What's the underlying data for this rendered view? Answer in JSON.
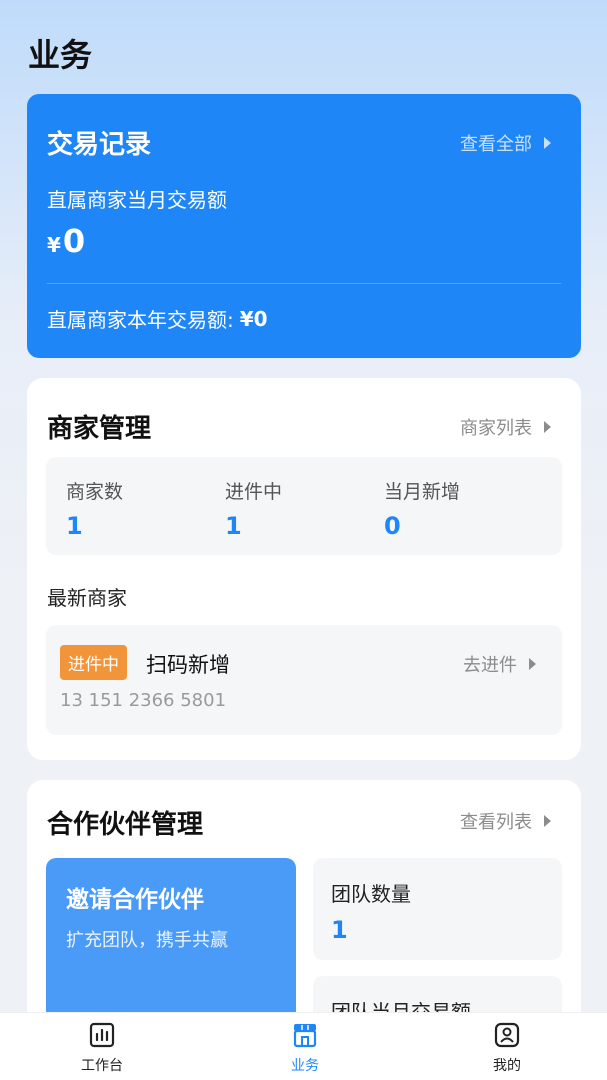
{
  "page": {
    "title": "业务"
  },
  "transactions": {
    "title": "交易记录",
    "view_all": "查看全部",
    "monthly_label": "直属商家当月交易额",
    "currency": "¥",
    "monthly_amount": "0",
    "yearly_label": "直属商家本年交易额:",
    "yearly_amount": "¥0"
  },
  "merchants": {
    "title": "商家管理",
    "list_link": "商家列表",
    "stats": [
      {
        "label": "商家数",
        "value": "1"
      },
      {
        "label": "进件中",
        "value": "1"
      },
      {
        "label": "当月新增",
        "value": "0"
      }
    ],
    "latest_title": "最新商家",
    "latest": {
      "badge": "进件中",
      "name": "扫码新增",
      "action": "去进件",
      "phone": "13 151 2366 5801"
    }
  },
  "partners": {
    "title": "合作伙伴管理",
    "list_link": "查看列表",
    "invite_title": "邀请合作伙伴",
    "invite_sub": "扩充团队，携手共赢",
    "team_count_label": "团队数量",
    "team_count_value": "1",
    "team_tx_label": "团队当月交易额"
  },
  "nav": [
    {
      "label": "工作台",
      "icon": "bar-chart-icon"
    },
    {
      "label": "业务",
      "icon": "store-icon",
      "active": true
    },
    {
      "label": "我的",
      "icon": "user-icon"
    }
  ],
  "colors": {
    "accent": "#1f86f8",
    "badge": "#f2953a"
  }
}
